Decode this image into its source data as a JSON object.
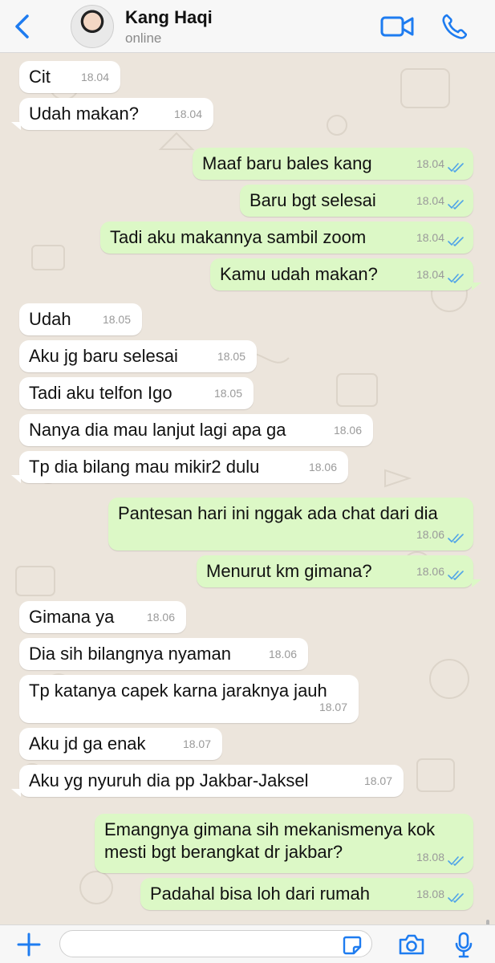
{
  "header": {
    "contact_name": "Kang Haqi",
    "status": "online",
    "back_icon": "chevron-left-icon",
    "video_icon": "video-call-icon",
    "phone_icon": "phone-call-icon",
    "accent_color": "#1e7cf0"
  },
  "messages": [
    {
      "dir": "in",
      "text": "Cit",
      "time": "18.04"
    },
    {
      "dir": "in",
      "text": "Udah makan?",
      "time": "18.04"
    },
    {
      "dir": "out",
      "text": "Maaf baru bales kang",
      "time": "18.04",
      "read": true
    },
    {
      "dir": "out",
      "text": "Baru bgt selesai",
      "time": "18.04",
      "read": true
    },
    {
      "dir": "out",
      "text": "Tadi aku makannya sambil zoom",
      "time": "18.04",
      "read": true
    },
    {
      "dir": "out",
      "text": "Kamu udah makan?",
      "time": "18.04",
      "read": true
    },
    {
      "dir": "in",
      "text": "Udah",
      "time": "18.05"
    },
    {
      "dir": "in",
      "text": "Aku jg baru selesai",
      "time": "18.05"
    },
    {
      "dir": "in",
      "text": "Tadi aku telfon Igo",
      "time": "18.05"
    },
    {
      "dir": "in",
      "text": "Nanya dia mau lanjut lagi apa ga",
      "time": "18.06"
    },
    {
      "dir": "in",
      "text": "Tp dia bilang mau mikir2 dulu",
      "time": "18.06"
    },
    {
      "dir": "out",
      "text": "Pantesan hari ini nggak ada chat dari dia",
      "time": "18.06",
      "read": true
    },
    {
      "dir": "out",
      "text": "Menurut km gimana?",
      "time": "18.06",
      "read": true
    },
    {
      "dir": "in",
      "text": "Gimana ya",
      "time": "18.06"
    },
    {
      "dir": "in",
      "text": "Dia sih bilangnya nyaman",
      "time": "18.06"
    },
    {
      "dir": "in",
      "text": "Tp katanya capek karna jaraknya jauh",
      "time": "18.07"
    },
    {
      "dir": "in",
      "text": "Aku jd ga enak",
      "time": "18.07"
    },
    {
      "dir": "in",
      "text": "Aku yg nyuruh dia pp Jakbar-Jaksel",
      "time": "18.07"
    },
    {
      "dir": "out",
      "text": "Emangnya gimana sih mekanismenya kok\nmesti bgt berangkat dr jakbar?",
      "time": "18.08",
      "read": true
    },
    {
      "dir": "out",
      "text": "Padahal bisa loh dari rumah",
      "time": "18.08",
      "read": true
    }
  ],
  "footer": {
    "input_value": "",
    "attach_icon": "plus-icon",
    "sticker_icon": "sticker-icon",
    "camera_icon": "camera-icon",
    "mic_icon": "microphone-icon"
  },
  "colors": {
    "chat_background": "#ece5dc",
    "incoming_bubble": "#ffffff",
    "outgoing_bubble": "#dcf8c6",
    "read_ticks": "#4fa3e8"
  }
}
